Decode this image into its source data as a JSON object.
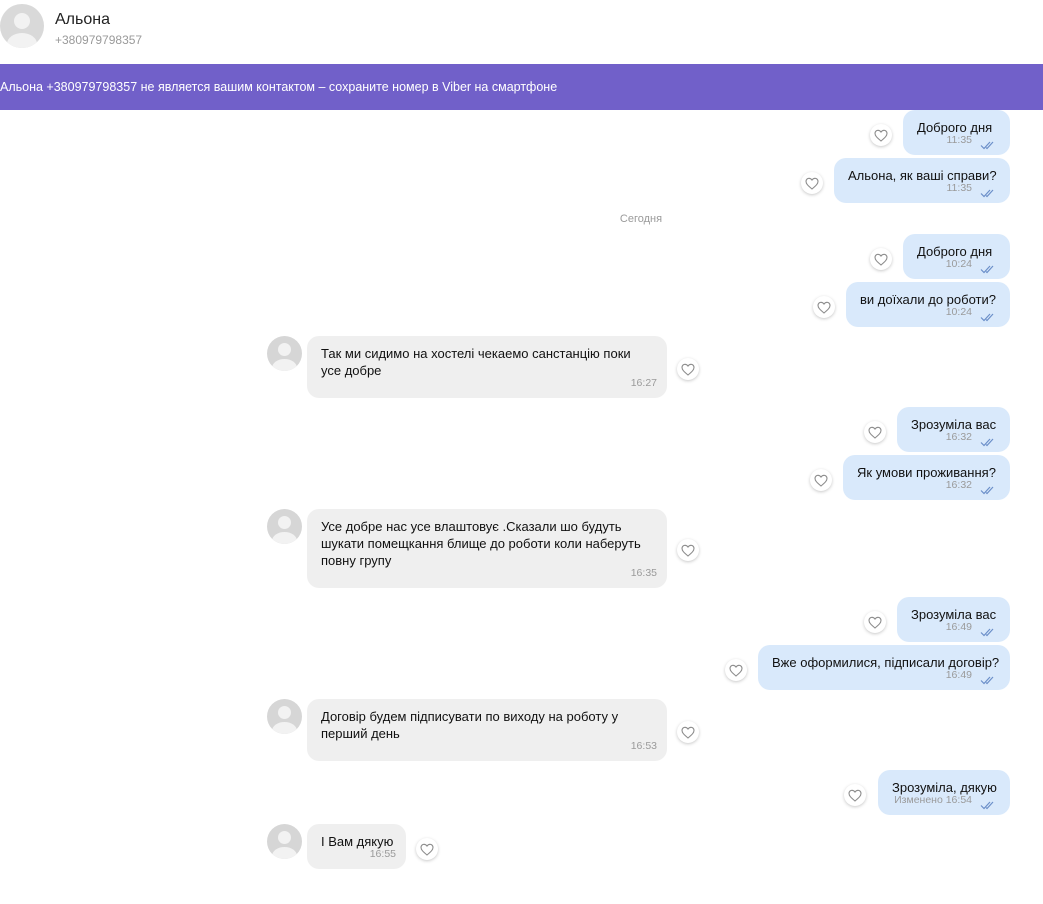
{
  "header": {
    "name": "Альона",
    "phone": "+380979798357"
  },
  "banner": {
    "text": "Альона +380979798357 не является вашим контактом – сохраните номер в Viber на смартфоне"
  },
  "date_separator": "Сегодня",
  "messages": [
    {
      "dir": "out",
      "lines": [
        "Доброго дня"
      ],
      "time": "11:35"
    },
    {
      "dir": "out",
      "lines": [
        "Альона, як ваші справи?"
      ],
      "time": "11:35"
    },
    {
      "dir": "out",
      "lines": [
        "Доброго дня"
      ],
      "time": "10:24"
    },
    {
      "dir": "out",
      "lines": [
        "ви доїхали до роботи?"
      ],
      "time": "10:24"
    },
    {
      "dir": "in",
      "lines": [
        "Так  ми сидимо на хостелі чекаемо санстанцію поки",
        "усе добре"
      ],
      "time": "16:27"
    },
    {
      "dir": "out",
      "lines": [
        "Зрозуміла вас"
      ],
      "time": "16:32"
    },
    {
      "dir": "out",
      "lines": [
        "Як умови проживання?"
      ],
      "time": "16:32"
    },
    {
      "dir": "in",
      "lines": [
        "Усе добре  нас усе влаштовує .Сказали шо будуть",
        "шукати помещкання блище до роботи коли наберуть",
        "повну групу"
      ],
      "time": "16:35"
    },
    {
      "dir": "out",
      "lines": [
        "Зрозуміла вас"
      ],
      "time": "16:49"
    },
    {
      "dir": "out",
      "lines": [
        "Вже оформилися, підписали договір?"
      ],
      "time": "16:49"
    },
    {
      "dir": "in",
      "lines": [
        "Договір будем підписувати по виходу на роботу у",
        "перший день"
      ],
      "time": "16:53"
    },
    {
      "dir": "out",
      "lines": [
        "Зрозуміла, дякую"
      ],
      "time": "Изменено 16:54"
    },
    {
      "dir": "in",
      "lines": [
        "І Вам дякую"
      ],
      "time": "16:55"
    }
  ],
  "icons": {
    "avatar": "avatar-icon",
    "like": "heart-icon",
    "read": "double-check-icon"
  },
  "colors": {
    "banner": "#7160c9",
    "outgoing": "#d9e9fb",
    "incoming": "#efefef",
    "ticks": "#6b8fc9"
  }
}
